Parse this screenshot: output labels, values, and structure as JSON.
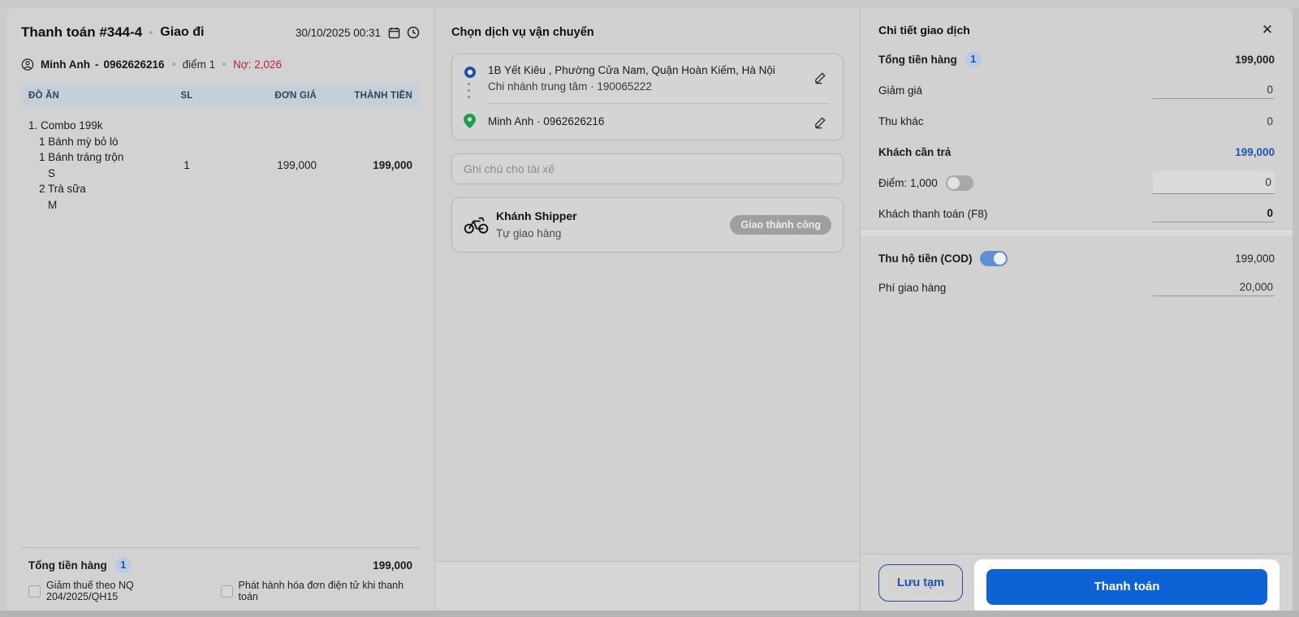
{
  "colors": {
    "primary_blue": "#0d62d6",
    "link_blue": "#1d55b4",
    "debt_red": "#b8262c",
    "pin_green": "#1d9e4f",
    "origin_blue": "#1d4fae",
    "table_header_bg": "#c5cfd9",
    "spotlight_white": "#ffffff",
    "badge_bg": "#b9cbe4"
  },
  "left_panel": {
    "title": "Thanh toán #344-4",
    "order_type": "Giao đi",
    "datetime": "30/10/2025 00:31",
    "customer": {
      "name": "Minh Anh",
      "dash": "-",
      "phone": "0962626216",
      "points": "điểm 1",
      "debt": "Nợ: 2,026"
    },
    "table": {
      "headers": [
        "ĐỒ ĂN",
        "SL",
        "ĐƠN GIÁ",
        "THÀNH TIỀN"
      ],
      "items": [
        {
          "name": "1. Combo 199k",
          "sub_items": [
            "1 Bánh mỳ bỏ lò",
            "1 Bánh tráng trộn",
            "S",
            "2 Trà sữa",
            "M"
          ],
          "qty": "1",
          "unit_price": "199,000",
          "total": "199,000"
        }
      ]
    },
    "footer": {
      "total_label": "Tổng tiền hàng",
      "total_count": "1",
      "total_value": "199,000",
      "checkbox_tax": "Giảm thuế theo NQ 204/2025/QH15",
      "checkbox_invoice": "Phát hành hóa đơn điện tử khi thanh toán"
    }
  },
  "middle_panel": {
    "heading": "Chọn dịch vụ vận chuyển",
    "address_card": {
      "pickup_address": "1B Yết Kiêu , Phường Cửa Nam, Quận Hoàn Kiếm, Hà Nội",
      "branch_line": "Chi nhánh trung tâm · 190065222",
      "recipient_line": "Minh Anh · 0962626216"
    },
    "note_placeholder": "Ghi chú cho tài xế",
    "shipper_card": {
      "name": "Khánh Shipper",
      "method": "Tự giao hàng",
      "status": "Giao thành công"
    }
  },
  "right_panel": {
    "heading": "Chi tiết giao dịch",
    "total_label": "Tổng tiền hàng",
    "total_count": "1",
    "total_value": "199,000",
    "discount_label": "Giảm giá",
    "discount_value": "0",
    "other_income_label": "Thu khác",
    "other_income_value": "0",
    "due_label": "Khách cần trả",
    "due_value": "199,000",
    "points_label": "Điểm: 1,000",
    "points_value": "0",
    "paid_label": "Khách thanh toán (F8)",
    "paid_value": "0",
    "cod_label": "Thu hộ tiền (COD)",
    "cod_value": "199,000",
    "shipping_fee_label": "Phí giao hàng",
    "shipping_fee_value": "20,000",
    "save_draft_label": "Lưu tạm",
    "pay_label": "Thanh toán"
  }
}
